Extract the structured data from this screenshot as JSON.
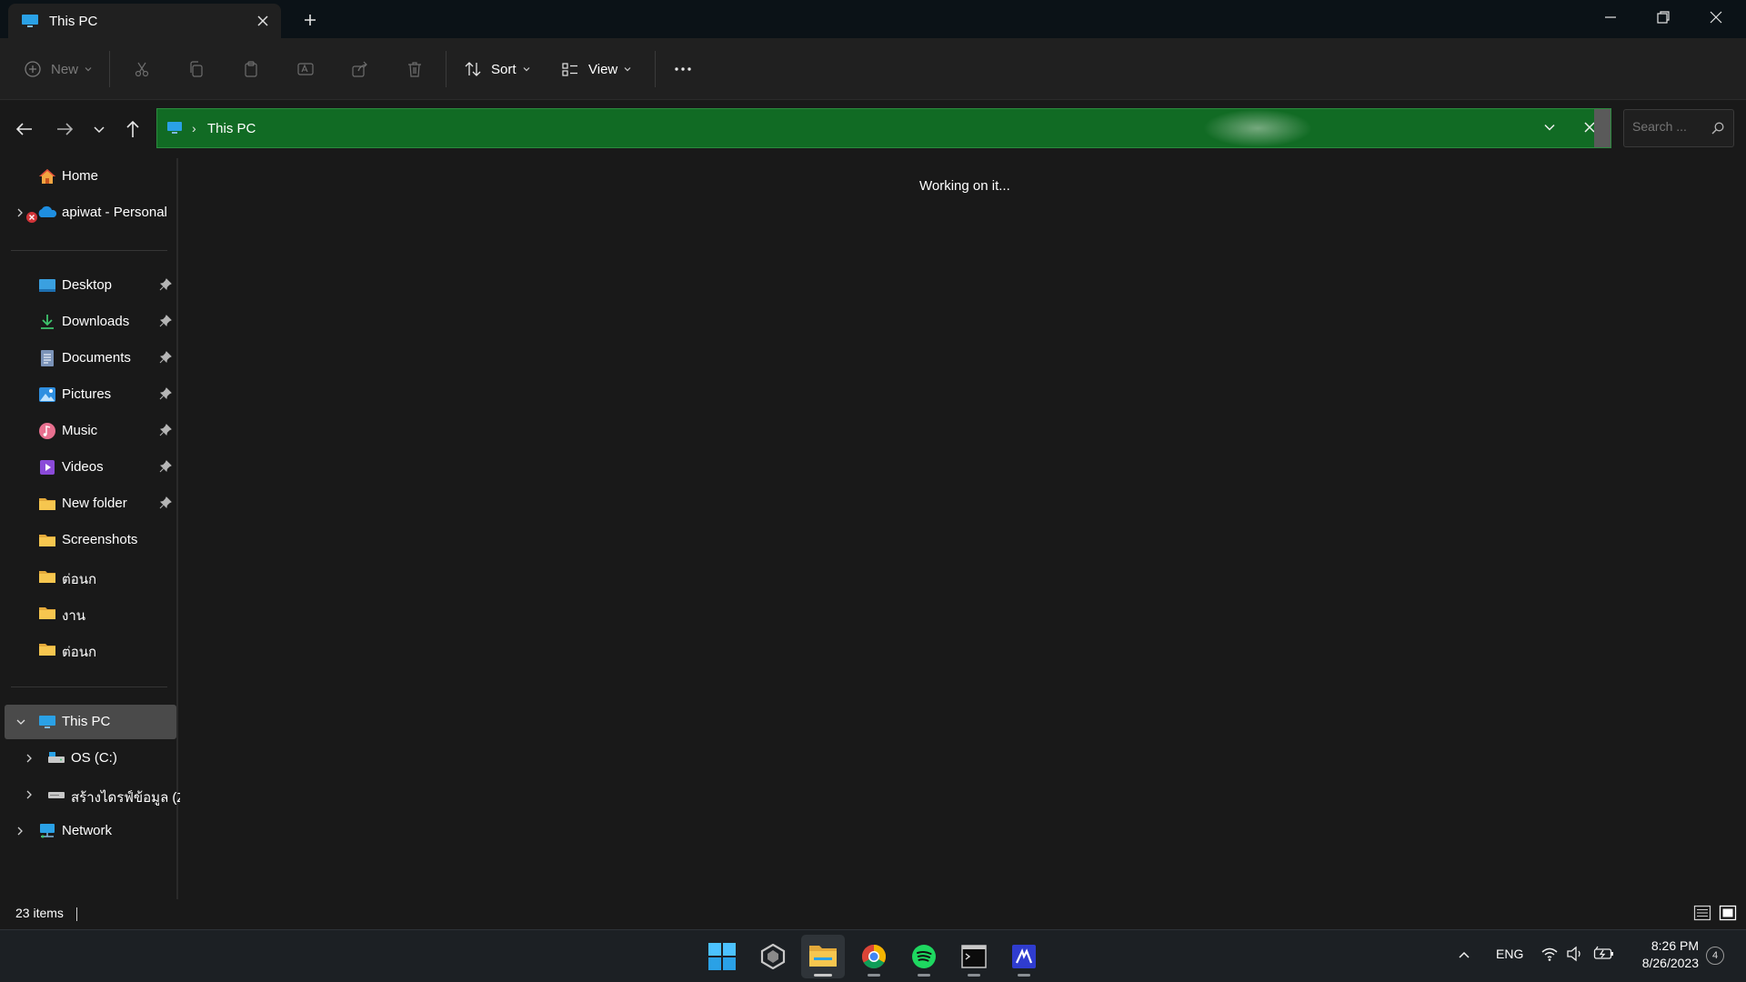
{
  "window": {
    "tab_title": "This PC",
    "minimize_icon": "minimize-icon",
    "restore_icon": "restore-icon",
    "close_icon": "close-icon"
  },
  "toolbar": {
    "new_label": "New",
    "sort_label": "Sort",
    "view_label": "View"
  },
  "address": {
    "path": "This PC",
    "search_placeholder": "Search ...",
    "accent_color": "#116b24"
  },
  "sidebar": {
    "home": "Home",
    "onedrive": "apiwat - Personal",
    "quick_access": [
      {
        "label": "Desktop",
        "icon": "desktop-icon",
        "pinned": true
      },
      {
        "label": "Downloads",
        "icon": "download-icon",
        "pinned": true
      },
      {
        "label": "Documents",
        "icon": "documents-icon",
        "pinned": true
      },
      {
        "label": "Pictures",
        "icon": "pictures-icon",
        "pinned": true
      },
      {
        "label": "Music",
        "icon": "music-icon",
        "pinned": true
      },
      {
        "label": "Videos",
        "icon": "videos-icon",
        "pinned": true
      },
      {
        "label": "New folder",
        "icon": "folder-icon",
        "pinned": true
      },
      {
        "label": "Screenshots",
        "icon": "folder-icon",
        "pinned": false
      },
      {
        "label": "ต่อนก",
        "icon": "folder-icon",
        "pinned": false
      },
      {
        "label": "งาน",
        "icon": "folder-icon",
        "pinned": false
      },
      {
        "label": "ต่อนก",
        "icon": "folder-icon",
        "pinned": false
      }
    ],
    "this_pc": "This PC",
    "drives": [
      {
        "label": "OS (C:)",
        "icon": "drive-icon"
      },
      {
        "label": "สร้างไดรฟ์ข้อมูล (Z:)",
        "icon": "drive-icon"
      }
    ],
    "network": "Network"
  },
  "main": {
    "message": "Working on it..."
  },
  "status": {
    "item_count": "23 items"
  },
  "taskbar": {
    "apps": [
      "start-icon",
      "app-icon",
      "file-explorer-icon",
      "chrome-icon",
      "spotify-icon",
      "terminal-icon",
      "editor-icon"
    ],
    "language": "ENG",
    "time": "8:26 PM",
    "date": "8/26/2023",
    "notifications": "4"
  }
}
